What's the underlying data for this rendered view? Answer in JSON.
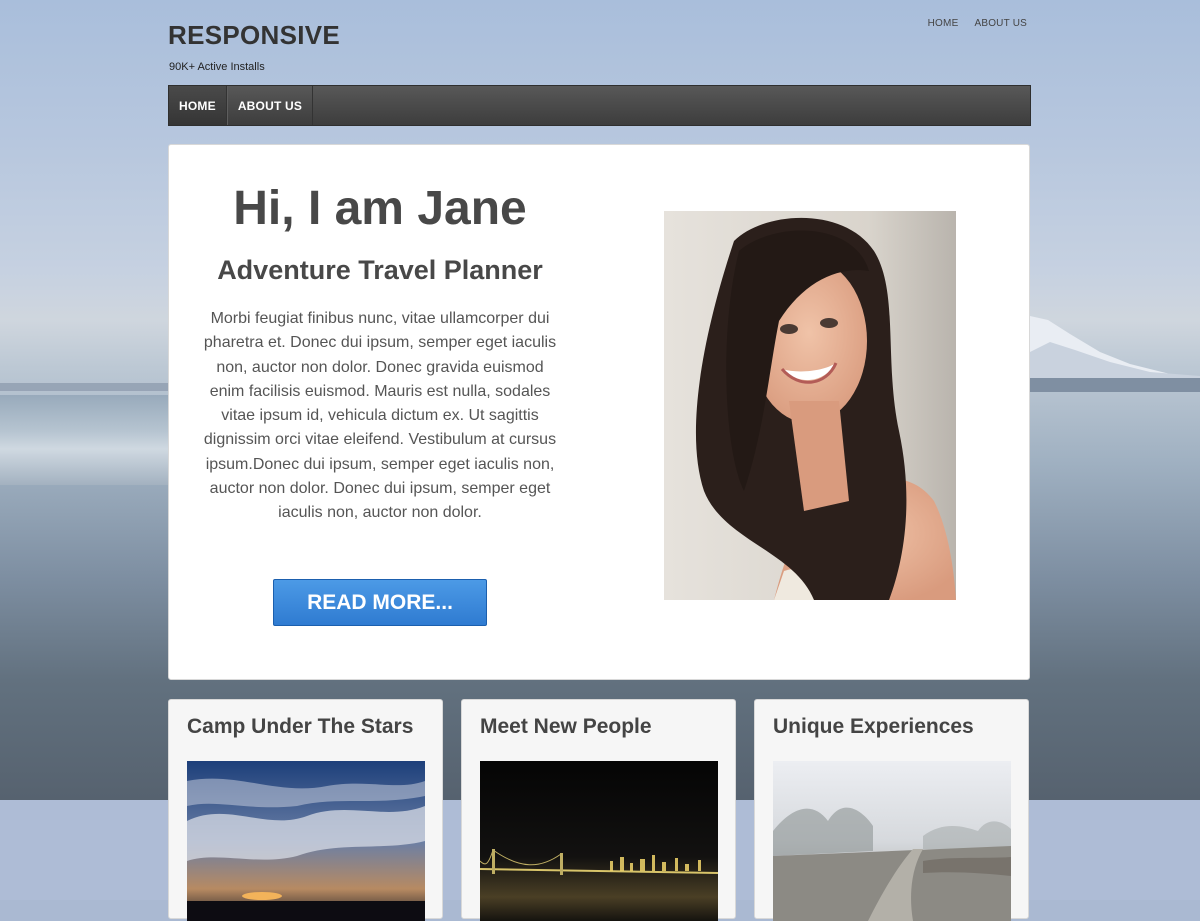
{
  "header": {
    "site_title": "RESPONSIVE",
    "tagline": "90K+ Active Installs",
    "top_menu": [
      {
        "label": "HOME"
      },
      {
        "label": "ABOUT US"
      }
    ]
  },
  "main_nav": {
    "items": [
      {
        "label": "HOME",
        "active": true
      },
      {
        "label": "ABOUT US",
        "active": false
      }
    ]
  },
  "hero": {
    "title": "Hi, I am Jane",
    "subtitle": "Adventure Travel Planner",
    "body": "Morbi feugiat finibus nunc, vitae ullamcorper dui pharetra et. Donec dui ipsum, semper eget iaculis non, auctor non dolor. Donec gravida euismod enim facilisis euismod. Mauris est nulla, sodales vitae ipsum id, vehicula dictum ex. Ut sagittis dignissim orci vitae eleifend. Vestibulum at cursus ipsum.Donec dui ipsum, semper eget iaculis non, auctor non dolor. Donec dui ipsum, semper eget iaculis non, auctor non dolor.",
    "button_label": "READ MORE...",
    "image": "portrait-photo"
  },
  "features": [
    {
      "title": "Camp Under The Stars",
      "image": "sunset-sky-photo"
    },
    {
      "title": "Meet New People",
      "image": "night-bridge-photo"
    },
    {
      "title": "Unique Experiences",
      "image": "foggy-path-photo"
    }
  ],
  "colors": {
    "nav_bg": "#3d3d3d",
    "button_blue": "#2f7bd1",
    "heading_text": "#484848"
  }
}
